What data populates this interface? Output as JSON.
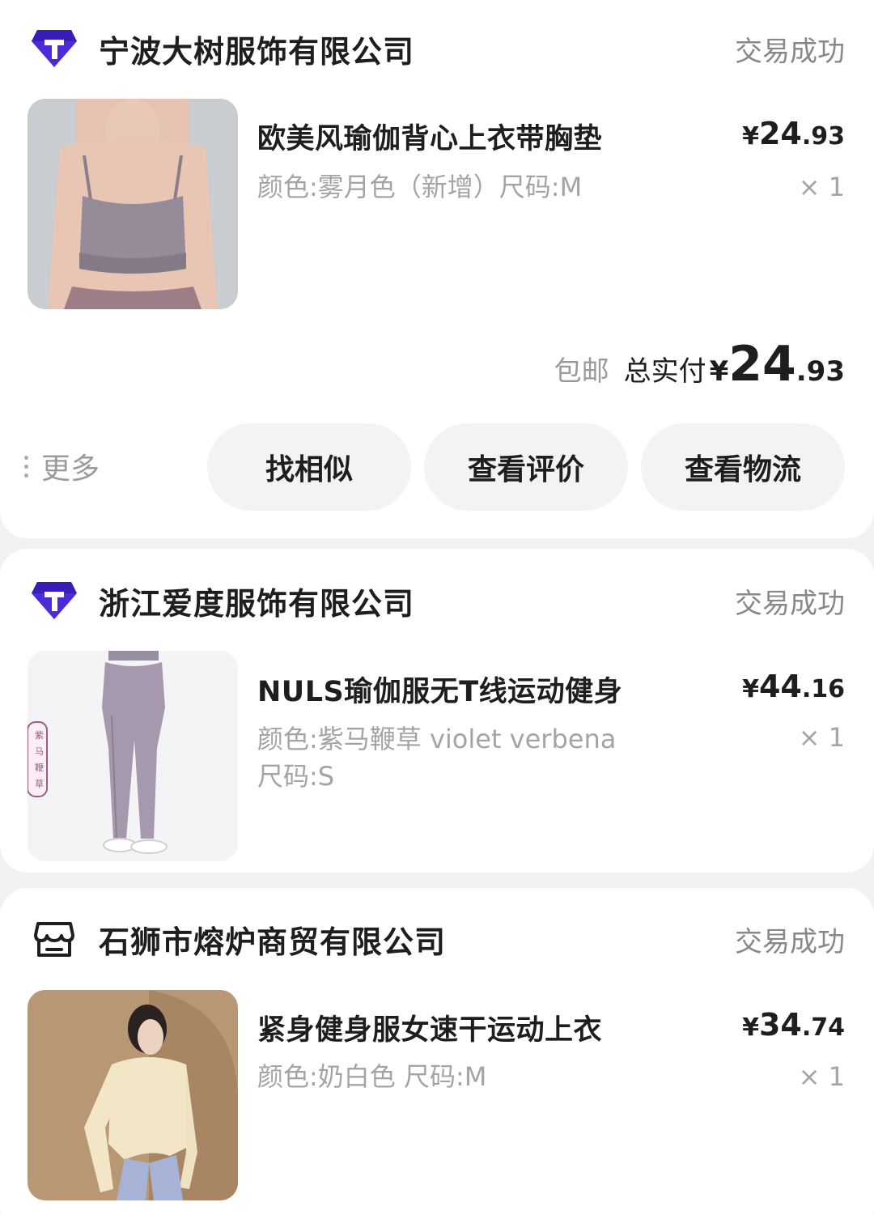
{
  "orders": [
    {
      "shop_name": "宁波大树服饰有限公司",
      "shop_icon": "tmall-diamond-icon",
      "status": "交易成功",
      "product": {
        "title": "欧美风瑜伽背心上衣带胸垫",
        "spec_line1": "颜色:雾月色（新增）尺码:M",
        "spec_line2": "",
        "price_currency": "¥",
        "price_int": "24",
        "price_dec": ".93",
        "qty": "× 1",
        "image": "yoga-tank-top-photo"
      },
      "summary": {
        "free_shipping": "包邮",
        "total_label": "总实付",
        "total_currency": "¥",
        "total_int": "24",
        "total_dec": ".93"
      },
      "actions": {
        "more": "更多",
        "similar": "找相似",
        "review": "查看评价",
        "logistics": "查看物流"
      }
    },
    {
      "shop_name": "浙江爱度服饰有限公司",
      "shop_icon": "tmall-diamond-icon",
      "status": "交易成功",
      "product": {
        "title": "NULS瑜伽服无T线运动健身",
        "spec_line1": "颜色:紫马鞭草 violet verbena",
        "spec_line2": "尺码:S",
        "price_currency": "¥",
        "price_int": "44",
        "price_dec": ".16",
        "qty": "× 1",
        "image": "yoga-leggings-photo",
        "image_tag": [
          "紫",
          "马",
          "鞭",
          "草"
        ]
      }
    },
    {
      "shop_name": "石狮市熔炉商贸有限公司",
      "shop_icon": "store-icon",
      "status": "交易成功",
      "product": {
        "title": "紧身健身服女速干运动上衣",
        "spec_line1": "颜色:奶白色 尺码:M",
        "spec_line2": "",
        "price_currency": "¥",
        "price_int": "34",
        "price_dec": ".74",
        "qty": "× 1",
        "image": "fitness-top-photo"
      }
    }
  ],
  "colors": {
    "tmall_purple": "#4b2bd9",
    "text_primary": "#1e1e1e",
    "text_secondary": "#a4a4a4",
    "button_bg": "#f3f3f3"
  }
}
